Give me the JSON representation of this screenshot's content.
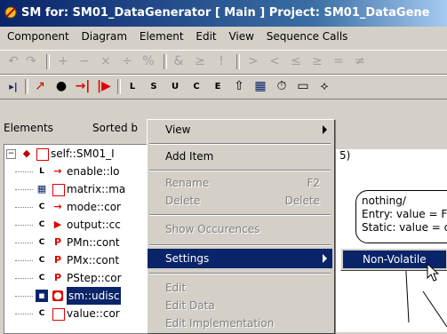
{
  "window": {
    "title": "SM for: SM01_DataGenerator [ Main ] Project: SM01_DataGene"
  },
  "menubar": [
    "Component",
    "Diagram",
    "Element",
    "Edit",
    "View",
    "Sequence Calls"
  ],
  "toolbar1": [
    "undo-icon",
    "redo-icon",
    "plus-icon",
    "minus-icon",
    "multiply-icon",
    "divide-icon",
    "percent-icon",
    "and-icon",
    "gte-icon",
    "not-icon",
    "gt-icon",
    "lt-icon",
    "le-icon",
    "ge-icon",
    "eq-icon",
    "ne-icon"
  ],
  "toolbar2": [
    "init-icon",
    "transition-icon",
    "connector-icon",
    "input-icon",
    "output-icon",
    "action-l-icon",
    "action-s-icon",
    "action-u-icon",
    "action-c-icon",
    "action-e-icon",
    "event-icon",
    "matrix-icon",
    "timer-icon",
    "wire-icon",
    "junction-icon"
  ],
  "panel": {
    "elements_label": "Elements",
    "sorted_label": "Sorted b"
  },
  "tree": [
    {
      "label": "self::SM01_I"
    },
    {
      "label": "enable::lo"
    },
    {
      "label": "matrix::ma"
    },
    {
      "label": "mode::cor"
    },
    {
      "label": "output::cc"
    },
    {
      "label": "PMn::cont"
    },
    {
      "label": "PMx::cont"
    },
    {
      "label": "PStep::cor"
    },
    {
      "label": "sm::udisc"
    },
    {
      "label": "value::cor"
    }
  ],
  "context_menu": {
    "view": "View",
    "add_item": "Add Item",
    "rename": "Rename",
    "rename_key": "F2",
    "delete": "Delete",
    "delete_key": "Delete",
    "show_occurences": "Show Occurences",
    "settings": "Settings",
    "edit": "Edit",
    "edit_data": "Edit Data",
    "edit_impl": "Edit Implementation"
  },
  "submenu": {
    "non_volatile": "Non-Volatile"
  },
  "canvas": {
    "state_marker": "5)",
    "state_line1": "nothing/",
    "state_line2": "Entry: value = F",
    "state_line3": "Static: value = c"
  },
  "colors": {
    "title_start": "#0a246a",
    "highlight": "#0a246a",
    "icon_red": "#e00000",
    "face": "#d4d0c8"
  }
}
